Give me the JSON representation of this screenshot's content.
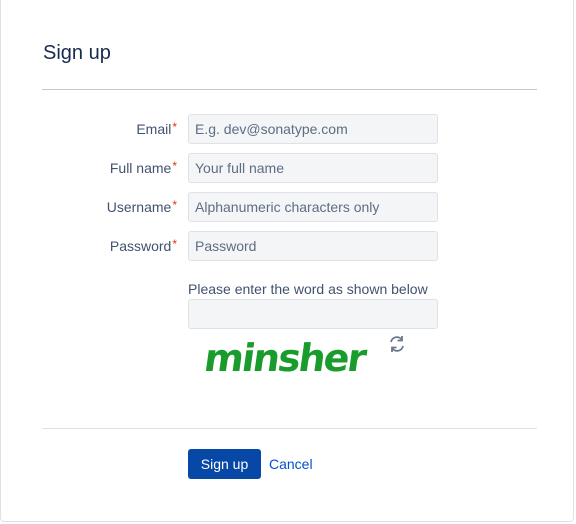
{
  "dialog": {
    "title": "Sign up"
  },
  "form": {
    "fields": [
      {
        "label": "Email",
        "required_mark": "*",
        "placeholder": "E.g. dev@sonatype.com",
        "value": ""
      },
      {
        "label": "Full name",
        "required_mark": "*",
        "placeholder": "Your full name",
        "value": ""
      },
      {
        "label": "Username",
        "required_mark": "*",
        "placeholder": "Alphanumeric characters only",
        "value": ""
      },
      {
        "label": "Password",
        "required_mark": "*",
        "placeholder": "Password",
        "value": ""
      }
    ],
    "captcha": {
      "prompt": "Please enter the word as shown below",
      "value": "",
      "word": "minsher",
      "word_color": "#1a9c2c",
      "refresh_icon": "refresh-icon"
    }
  },
  "actions": {
    "submit_label": "Sign up",
    "cancel_label": "Cancel"
  },
  "colors": {
    "primary": "#0747a6",
    "link": "#0052cc",
    "required": "#de350b"
  }
}
